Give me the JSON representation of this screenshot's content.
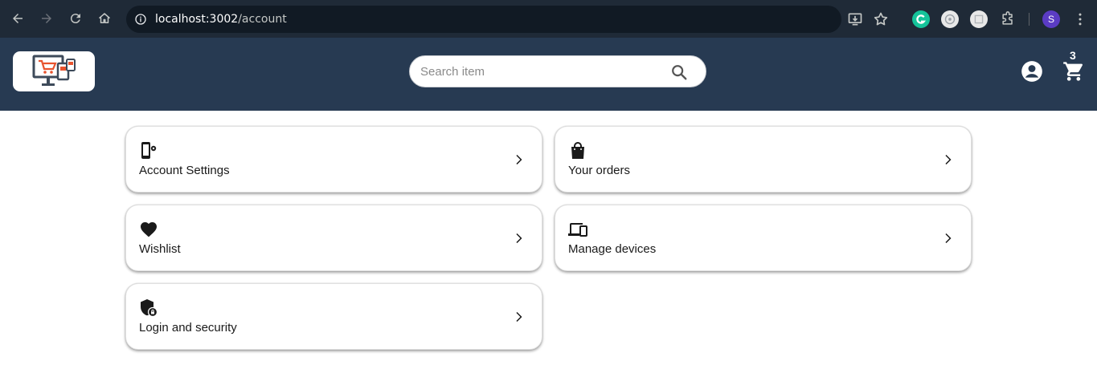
{
  "browser": {
    "url_host": "localhost:3002",
    "url_path": "/account",
    "profile_initial": "S"
  },
  "header": {
    "search": {
      "placeholder": "Search item"
    },
    "cart_count": "3"
  },
  "cards": [
    {
      "label": "Account Settings",
      "icon": "phone-settings-icon"
    },
    {
      "label": "Your orders",
      "icon": "shopping-bag-icon"
    },
    {
      "label": "Wishlist",
      "icon": "heart-icon"
    },
    {
      "label": "Manage devices",
      "icon": "devices-icon"
    },
    {
      "label": "Login and security",
      "icon": "shield-lock-icon"
    }
  ],
  "colors": {
    "chrome_bg": "#1f2a37",
    "header_bg": "#273a52",
    "profile_badge": "#5b3cc4",
    "logo_red": "#e8532e"
  }
}
